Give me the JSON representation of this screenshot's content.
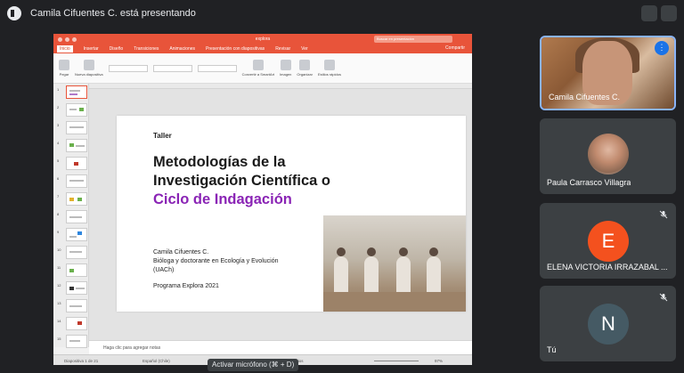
{
  "meeting": {
    "presenting_text": "Camila Cifuentes C. está presentando"
  },
  "app": {
    "title": "explora",
    "search_placeholder": "Buscar en presentación",
    "tabs": [
      "Inicio",
      "Insertar",
      "Diseño",
      "Transiciones",
      "Animaciones",
      "Presentación con diapositivas",
      "Revisar",
      "Ver"
    ],
    "share_label": "Compartir",
    "ribbon": {
      "paste": "Pegar",
      "new_slide": "Nueva diapositiva",
      "convert": "Convertir a SmartArt",
      "image": "Imagen",
      "arrange": "Organizar",
      "quick_styles": "Estilos rápidos"
    }
  },
  "thumbnails": [
    "1",
    "2",
    "3",
    "4",
    "5",
    "6",
    "7",
    "8",
    "9",
    "10",
    "11",
    "12",
    "13",
    "14",
    "15"
  ],
  "slide": {
    "kicker": "Taller",
    "title_line1": "Metodologías de la",
    "title_line2": "Investigación Científica o",
    "title_line3": "Ciclo de Indagación",
    "author": "Camila Cifuentes C.",
    "role_line1": "Bióloga y doctorante en Ecología y Evolución",
    "role_line2": "(UACh)",
    "program": "Programa Explora 2021"
  },
  "notes_placeholder": "Haga clic para agregar notas",
  "status": {
    "slide_count": "Diapositiva 1 de 21",
    "language": "Español (Chile)",
    "comments": "Comentarios",
    "zoom": "97%"
  },
  "tooltip": "Activar micrófono (⌘ + D)",
  "participants": [
    {
      "name": "Camila Cifuentes C.",
      "initial": ""
    },
    {
      "name": "Paula Carrasco Villagra",
      "initial": ""
    },
    {
      "name": "ELENA VICTORIA IRRAZABAL ...",
      "initial": "E",
      "color": "#f4511e"
    },
    {
      "name": "Tú",
      "initial": "N",
      "color": "#455a64"
    }
  ],
  "colors": {
    "accent_ribbon": "#e8543a",
    "title_purple": "#8a24b5",
    "tile_bg": "#3c4043",
    "speaking_border": "#8ab4f8"
  },
  "icons": [
    "present-icon",
    "more-vert-icon",
    "mic-off-icon"
  ]
}
